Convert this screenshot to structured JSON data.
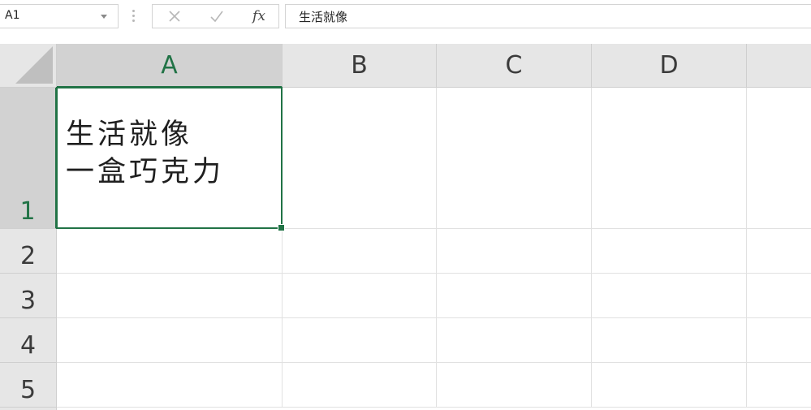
{
  "name_box": {
    "value": "A1"
  },
  "formula_bar": {
    "cancel_icon": "x-mark",
    "enter_icon": "check-mark",
    "fx_label": "fx",
    "value": "生活就像"
  },
  "columns": [
    "A",
    "B",
    "C",
    "D"
  ],
  "rows": [
    "1",
    "2",
    "3",
    "4",
    "5"
  ],
  "selected_cell": {
    "address": "A1",
    "lines": [
      "生活就像",
      "一盒巧克力"
    ]
  },
  "colors": {
    "accent": "#217346",
    "header_bg": "#e6e6e6",
    "header_selected_bg": "#d2d2d2",
    "gridline": "#e1e1e1"
  }
}
